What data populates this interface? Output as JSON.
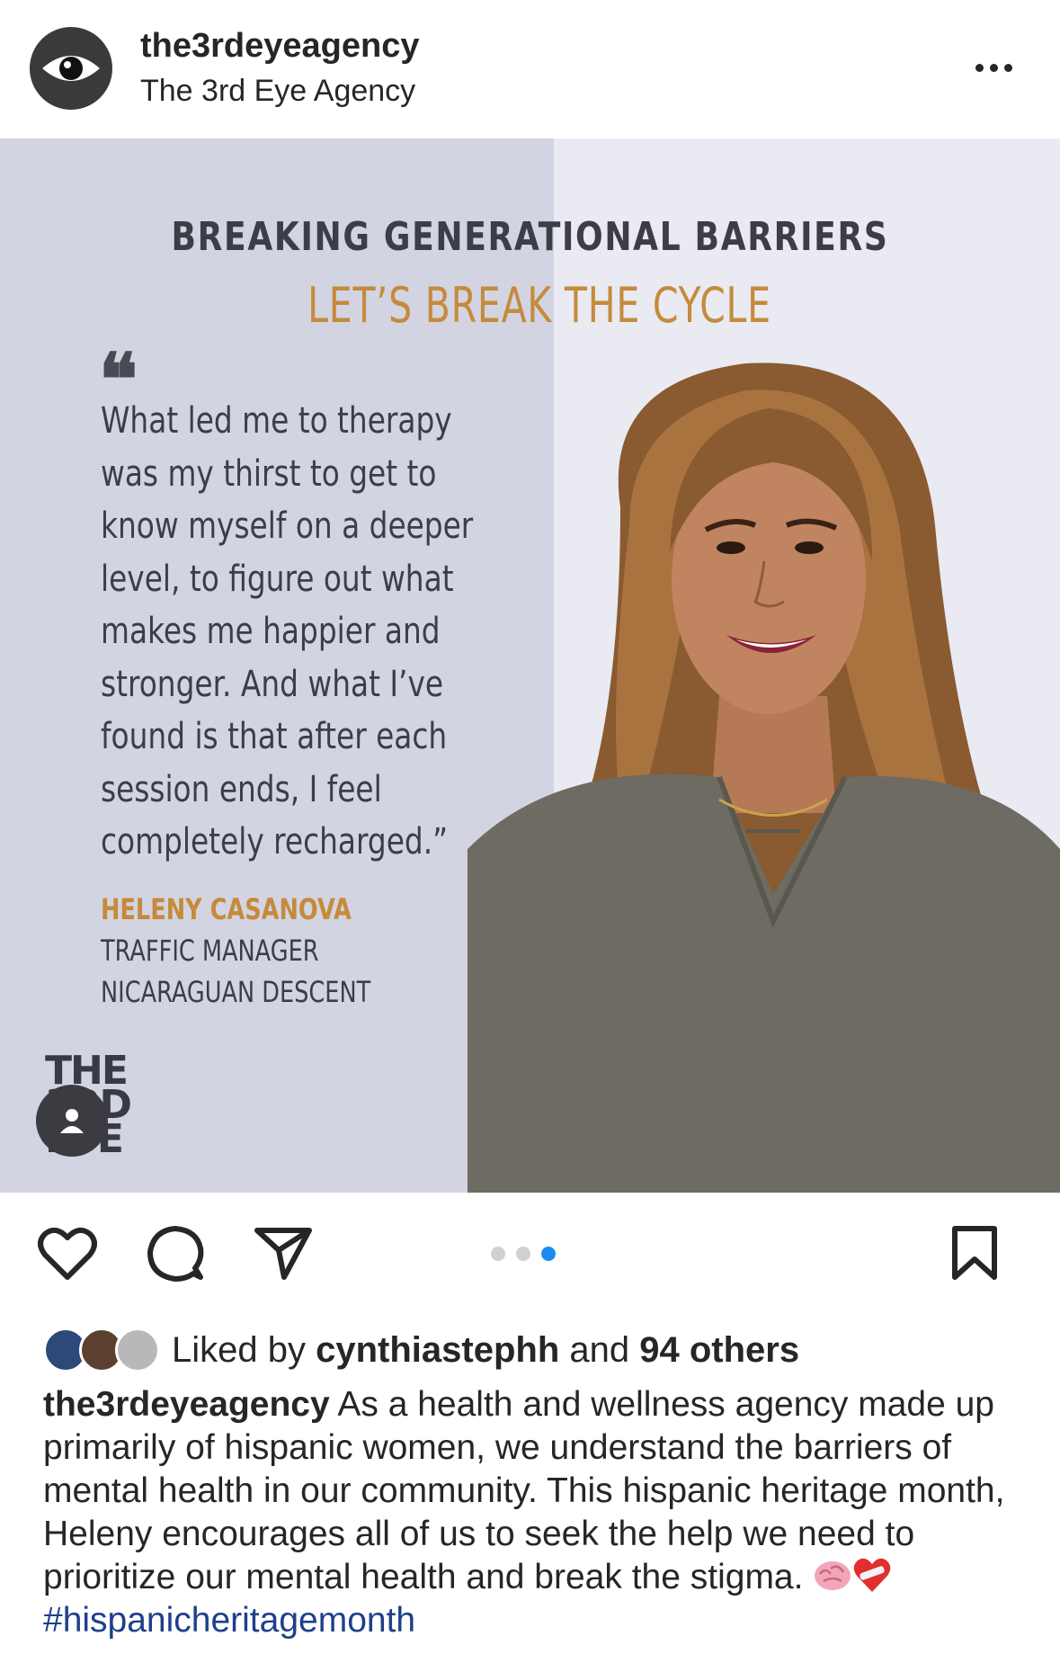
{
  "header": {
    "username": "the3rdeyeagency",
    "full_name": "The 3rd Eye Agency",
    "avatar_icon": "eye-icon",
    "more_icon": "more-options-icon"
  },
  "post_image": {
    "headline": "BREAKING GENERATIONAL BARRIERS",
    "subheadline": "LET’S BREAK THE CYCLE",
    "quote_mark": "❝",
    "quote_lines": [
      "What led me to therapy",
      "was my thirst to get to",
      "know myself on a deeper",
      "level, to figure out what",
      "makes me happier and",
      "stronger. And what I’ve",
      "found is that after each",
      "session ends, I feel",
      "completely recharged.”"
    ],
    "person_name": "HELENY CASANOVA",
    "person_title": "TRAFFIC MANAGER",
    "person_descent": "NICARAGUAN DESCENT",
    "logo_lines": [
      "THE",
      "3RD",
      "EYE"
    ],
    "accent_color": "#c58a3c",
    "carousel": {
      "count": 3,
      "active": 3
    }
  },
  "actions": {
    "like_icon": "heart-icon",
    "comment_icon": "comment-icon",
    "share_icon": "send-icon",
    "save_icon": "bookmark-icon"
  },
  "likes": {
    "prefix": "Liked by ",
    "user": "cynthiastephh",
    "middle": " and ",
    "others": "94 others"
  },
  "caption": {
    "username": "the3rdeyeagency",
    "text": " As a health and wellness agency made up primarily of hispanic women, we understand the barriers of mental health in our community. This hispanic heritage month, Heleny encourages all of us to seek the help we need to prioritize our mental health and break the stigma. ",
    "emojis": [
      "brain-emoji",
      "mending-heart-emoji"
    ],
    "hashtag": "#hispanicheritagemonth",
    "hashtag_color": "#1f3f8a"
  }
}
